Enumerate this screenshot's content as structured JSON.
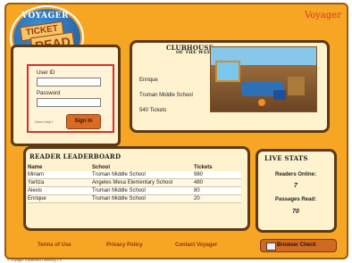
{
  "brand": {
    "small_title": "VOYAGER",
    "ticket_word": "TICKET",
    "read_word": "READ",
    "corner_logo": "Voyager"
  },
  "login": {
    "user_id_label": "User ID",
    "password_label": "Password",
    "forgot_label": "Need help?",
    "sign_in_label": "Sign In",
    "user_id_value": "",
    "password_value": ""
  },
  "clubhouse": {
    "title_line1": "CLUBHOUSE",
    "title_line2": "OF THE WEEK",
    "name": "Enrique",
    "school": "Truman Middle School",
    "tickets": "540 Tickets"
  },
  "leaderboard": {
    "title": "READER LEADERBOARD",
    "columns": [
      "Name",
      "School",
      "Tickets"
    ],
    "rows": [
      [
        "Miriam",
        "Truman Middle School",
        "980"
      ],
      [
        "Yaritza",
        "Angeles Mesa Elementary School",
        "480"
      ],
      [
        "Alexis",
        "Truman Middle School",
        "80"
      ],
      [
        "Enrique",
        "Truman Middle School",
        "20"
      ]
    ]
  },
  "live_stats": {
    "title": "LIVE STATS",
    "readers_online_label": "Readers Online:",
    "readers_online_value": "7",
    "passages_read_label": "Passages Read:",
    "passages_read_value": "70"
  },
  "footer": {
    "terms": "Terms of Use",
    "privacy": "Privacy Policy",
    "contact": "Contact Voyager",
    "browser_check": "Browser Check",
    "copyright": "© Voyager Expanded Learning 1.0"
  }
}
